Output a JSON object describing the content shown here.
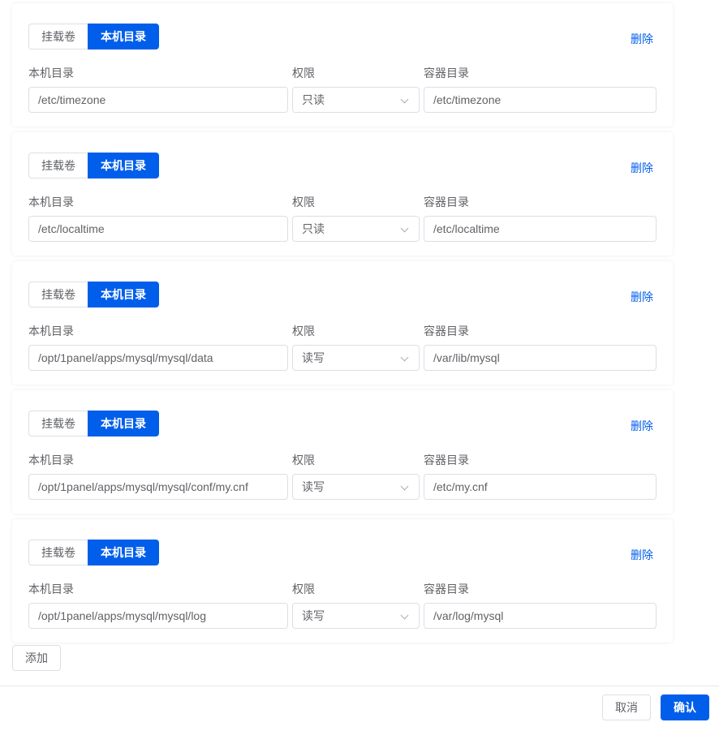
{
  "labels": {
    "volume_tab": "挂载卷",
    "host_dir_tab": "本机目录",
    "delete": "删除",
    "host_dir": "本机目录",
    "permission": "权限",
    "container_dir": "容器目录"
  },
  "mounts": [
    {
      "host": "/etc/timezone",
      "permission": "只读",
      "container": "/etc/timezone"
    },
    {
      "host": "/etc/localtime",
      "permission": "只读",
      "container": "/etc/localtime"
    },
    {
      "host": "/opt/1panel/apps/mysql/mysql/data",
      "permission": "读写",
      "container": "/var/lib/mysql"
    },
    {
      "host": "/opt/1panel/apps/mysql/mysql/conf/my.cnf",
      "permission": "读写",
      "container": "/etc/my.cnf"
    },
    {
      "host": "/opt/1panel/apps/mysql/mysql/log",
      "permission": "读写",
      "container": "/var/log/mysql"
    }
  ],
  "footer": {
    "add": "添加",
    "cancel": "取消",
    "confirm": "确认"
  },
  "colors": {
    "accent": "#005eeb",
    "border": "#dcdfe6",
    "text": "#606266"
  }
}
